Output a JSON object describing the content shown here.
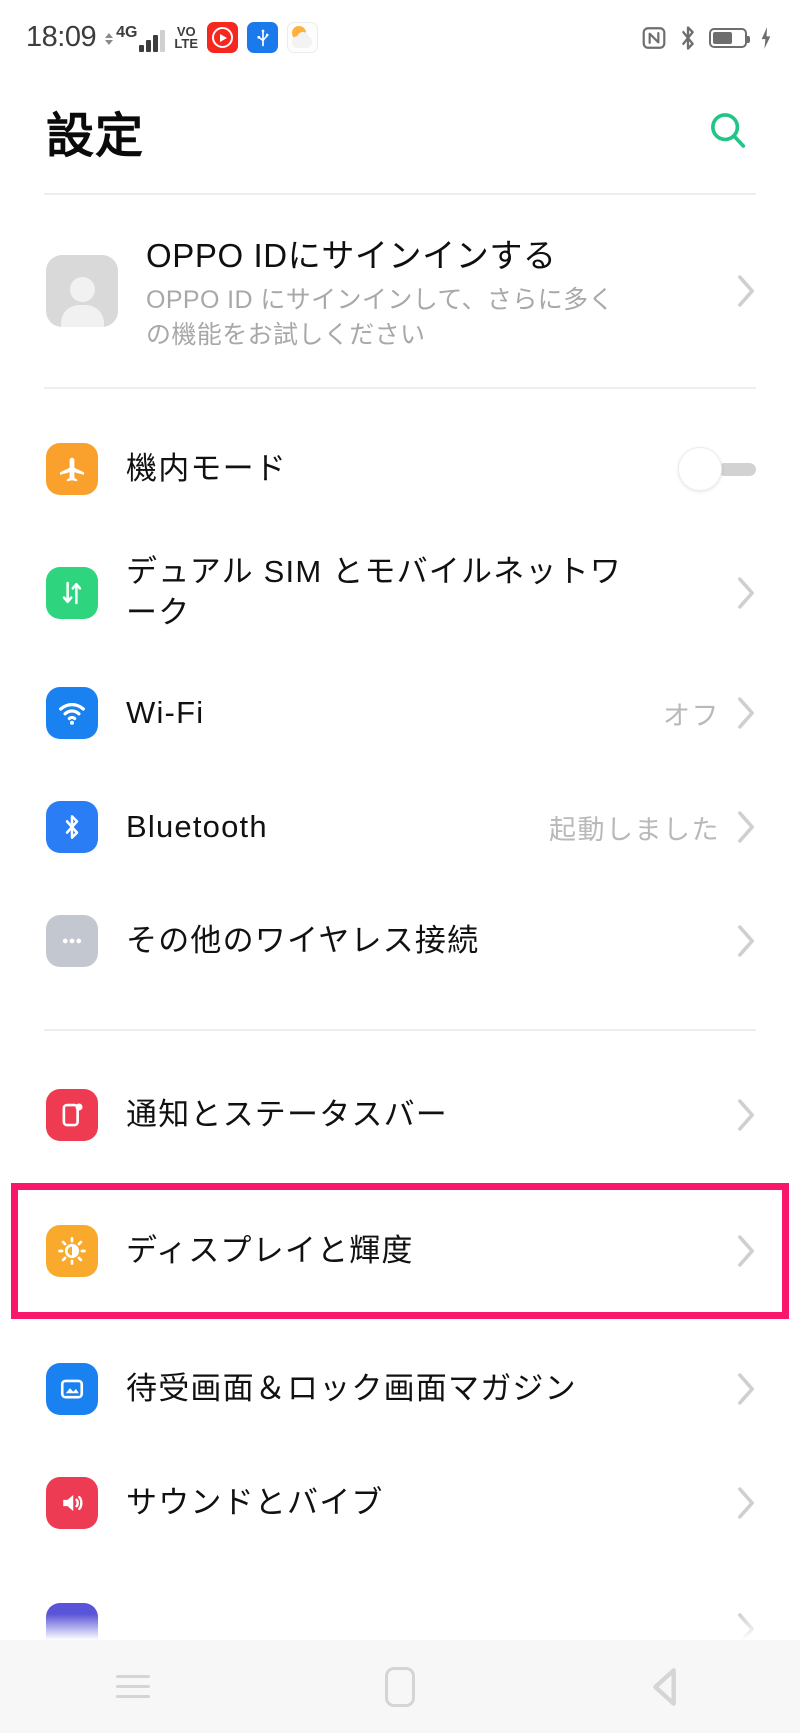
{
  "status_bar": {
    "time": "18:09",
    "network_type": "4G",
    "volte_label_line1": "VO",
    "volte_label_line2": "LTE",
    "icons_left": [
      "signal-updown-icon",
      "signal-bars-icon",
      "volte-icon",
      "youtube-icon",
      "usb-icon",
      "weather-icon"
    ],
    "icons_right": [
      "nfc-icon",
      "bluetooth-icon",
      "battery-icon",
      "charging-bolt-icon"
    ],
    "battery_level_percent": 62
  },
  "header": {
    "title": "設定",
    "search_icon": "search-icon",
    "search_color": "#22c585"
  },
  "account": {
    "title": "OPPO IDにサインインする",
    "subtitle": "OPPO ID にサインインして、さらに多くの機能をお試しください",
    "avatar_icon": "person-avatar-icon"
  },
  "groups": [
    {
      "id": "connectivity",
      "items": [
        {
          "label": "機内モード",
          "icon": "airplane-icon",
          "icon_color": "#f9a12c",
          "control": "toggle",
          "toggle_on": false,
          "value": ""
        },
        {
          "label": "デュアル SIM とモバイルネットワーク",
          "icon": "data-transfer-icon",
          "icon_color": "#2ed47e",
          "control": "chevron",
          "value": ""
        },
        {
          "label": "Wi-Fi",
          "icon": "wifi-icon",
          "icon_color": "#1a82f0",
          "control": "chevron",
          "value": "オフ"
        },
        {
          "label": "Bluetooth",
          "icon": "bluetooth-icon",
          "icon_color": "#2a7df4",
          "control": "chevron",
          "value": "起動しました"
        },
        {
          "label": "その他のワイヤレス接続",
          "icon": "more-dots-icon",
          "icon_color": "#c3c7cf",
          "control": "chevron",
          "value": ""
        }
      ]
    },
    {
      "id": "device",
      "items": [
        {
          "label": "通知とステータスバー",
          "icon": "notification-icon",
          "icon_color": "#ee3b51",
          "control": "chevron",
          "value": ""
        },
        {
          "label": "ディスプレイと輝度",
          "icon": "brightness-icon",
          "icon_color": "#f9a92c",
          "control": "chevron",
          "value": "",
          "highlighted": true
        },
        {
          "label": "待受画面＆ロック画面マガジン",
          "icon": "wallpaper-icon",
          "icon_color": "#1a82f0",
          "control": "chevron",
          "value": ""
        },
        {
          "label": "サウンドとバイブ",
          "icon": "sound-icon",
          "icon_color": "#ec3b52",
          "control": "chevron",
          "value": ""
        },
        {
          "label": "",
          "icon": "cut-off-icon",
          "icon_color": "#5a55d8",
          "control": "chevron",
          "value": ""
        }
      ]
    }
  ],
  "highlight": {
    "color": "#f8176b",
    "target_label": "ディスプレイと輝度"
  },
  "navbar": {
    "buttons": [
      "recents-button",
      "home-button",
      "back-button"
    ]
  }
}
